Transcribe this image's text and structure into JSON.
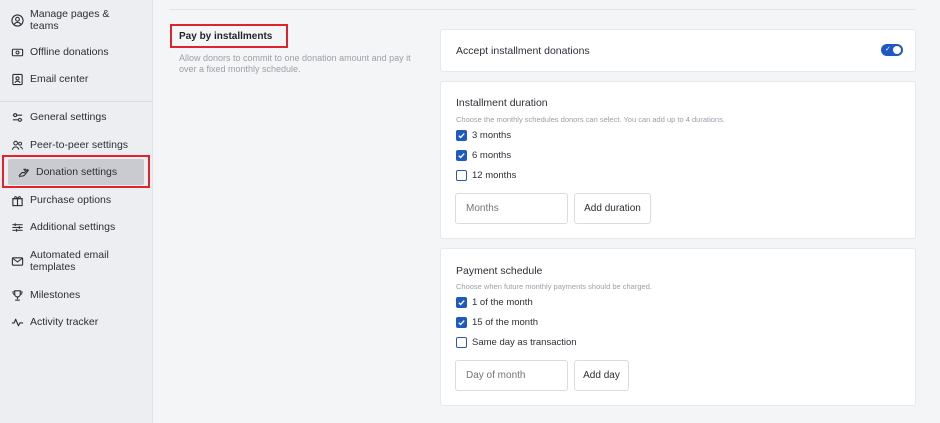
{
  "sidebar": {
    "items": [
      {
        "label": "Manage pages & teams",
        "icon": "user-circle-icon"
      },
      {
        "label": "Offline donations",
        "icon": "cash-icon"
      },
      {
        "label": "Email center",
        "icon": "contact-card-icon"
      },
      {
        "label": "General settings",
        "icon": "sliders-icon"
      },
      {
        "label": "Peer-to-peer settings",
        "icon": "people-icon"
      },
      {
        "label": "Donation settings",
        "icon": "hand-heart-icon"
      },
      {
        "label": "Purchase options",
        "icon": "gift-icon"
      },
      {
        "label": "Additional settings",
        "icon": "adjustments-icon"
      },
      {
        "label": "Automated email templates",
        "icon": "envelope-icon"
      },
      {
        "label": "Milestones",
        "icon": "trophy-icon"
      },
      {
        "label": "Activity tracker",
        "icon": "pulse-icon"
      }
    ],
    "active_label": "Donation settings"
  },
  "section": {
    "title": "Pay by installments",
    "description": "Allow donors to commit to one donation amount and pay it over a fixed monthly schedule."
  },
  "accept_card": {
    "label": "Accept installment donations",
    "enabled": true
  },
  "duration_card": {
    "title": "Installment duration",
    "subtitle": "Choose the monthly schedules donors can select. You can add up to 4 durations.",
    "options": [
      {
        "label": "3 months",
        "checked": true
      },
      {
        "label": "6 months",
        "checked": true
      },
      {
        "label": "12 months",
        "checked": false
      }
    ],
    "input_placeholder": "Months",
    "button_label": "Add duration"
  },
  "schedule_card": {
    "title": "Payment schedule",
    "subtitle": "Choose when future monthly payments should be charged.",
    "options": [
      {
        "label": "1 of the month",
        "checked": true
      },
      {
        "label": "15 of the month",
        "checked": true
      },
      {
        "label": "Same day as transaction",
        "checked": false
      }
    ],
    "input_placeholder": "Day of month",
    "button_label": "Add day"
  },
  "colors": {
    "accent": "#1f57c3",
    "highlight_red": "#e0242e",
    "sidebar_bg": "#eceef1",
    "active_bg": "#c9cbd0"
  }
}
